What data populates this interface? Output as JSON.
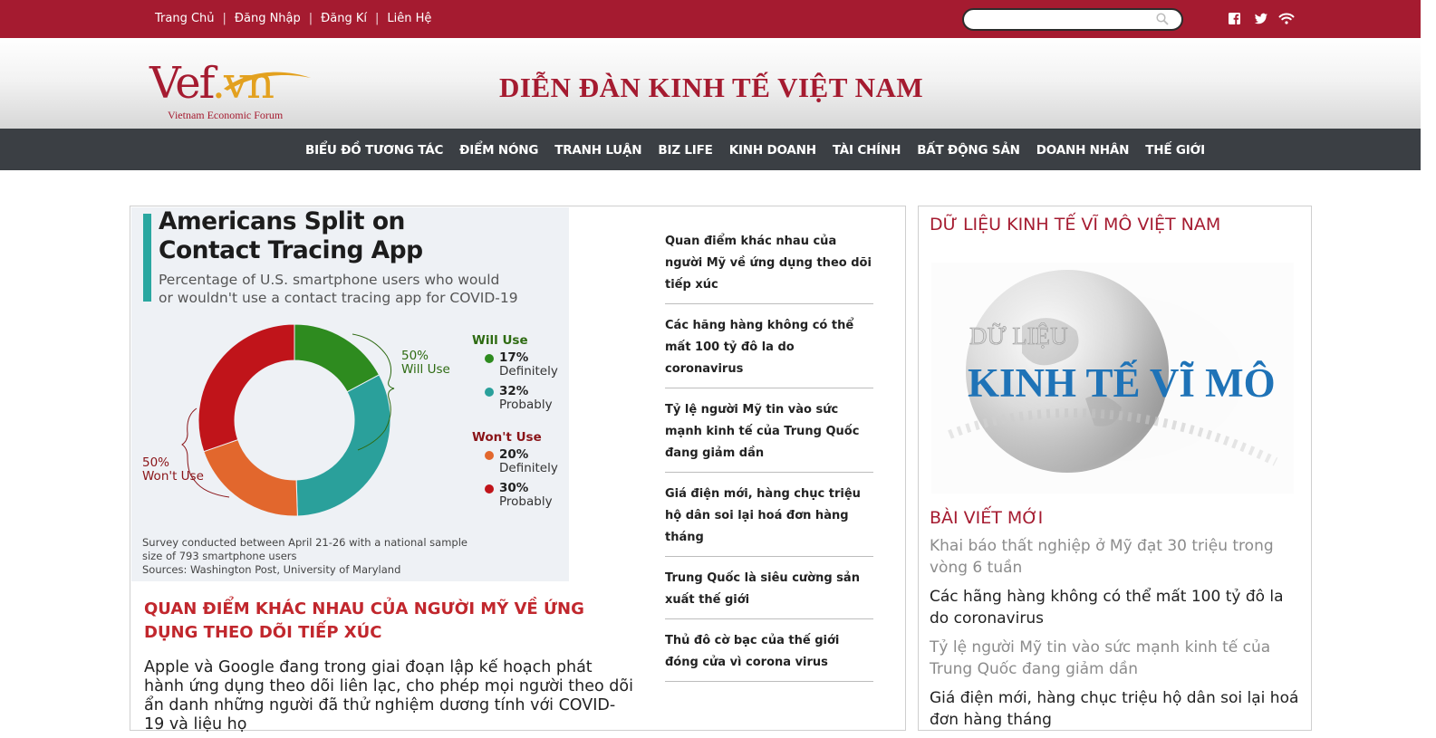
{
  "topbar": {
    "links": [
      "Trang Chủ",
      "Đăng Nhập",
      "Đăng Kí",
      "Liên Hệ"
    ],
    "search_placeholder": "",
    "social_icons": [
      "facebook-icon",
      "twitter-icon",
      "rss-icon"
    ]
  },
  "header": {
    "logo_text": "Vef",
    "logo_suffix": ".vn",
    "logo_tagline": "Vietnam Economic Forum",
    "site_title": "DIỄN ĐÀN KINH TẾ VIỆT NAM"
  },
  "nav": {
    "items": [
      "BIỂU ĐỒ TƯƠNG TÁC",
      "ĐIỂM NÓNG",
      "TRANH LUẬN",
      "BIZ LIFE",
      "KINH DOANH",
      "TÀI CHÍNH",
      "BẤT ĐỘNG SẢN",
      "DOANH NHÂN",
      "THẾ GIỚI"
    ]
  },
  "featured": {
    "image": {
      "title_line1": "Americans Split on",
      "title_line2": "Contact Tracing App",
      "subtitle_line1": "Percentage of U.S. smartphone users who would",
      "subtitle_line2": "or wouldn't use a contact tracing app for COVID-19",
      "will_use_label": "Will Use",
      "wont_use_label": "Won't Use",
      "will_pct": "50%",
      "will_group": "Will Use",
      "wont_pct": "50%",
      "wont_group": "Won't Use",
      "legend": [
        {
          "pct": "17%",
          "text": "Definitely",
          "color": "#2e8b1f"
        },
        {
          "pct": "32%",
          "text": "Probably",
          "color": "#2aa09b"
        },
        {
          "pct": "20%",
          "text": "Definitely",
          "color": "#e2672d"
        },
        {
          "pct": "30%",
          "text": "Probably",
          "color": "#c0141a"
        }
      ],
      "footnote_line1": "Survey conducted between April 21-26 with a national sample",
      "footnote_line2": "size of 793 smartphone users",
      "footnote_line3": "Sources: Washington Post, University of Maryland",
      "colors": {
        "will": "#2e6b12",
        "wont": "#8a1418",
        "bar": "#2aa7a0"
      }
    },
    "title": "QUAN ĐIỂM KHÁC NHAU CỦA NGƯỜI MỸ VỀ ỨNG DỤNG THEO DÕI TIẾP XÚC",
    "summary": "Apple và Google đang trong giai đoạn lập kế hoạch phát hành ứng dụng theo dõi liên lạc, cho phép mọi người theo dõi ẩn danh những người đã thử nghiệm dương tính với COVID-19 và liệu họ"
  },
  "related": [
    "Quan điểm khác nhau của người Mỹ về ứng dụng theo dõi tiếp xúc",
    "Các hãng hàng không có thể mất 100 tỷ đô la do coronavirus",
    "Tỷ lệ người Mỹ tin vào sức mạnh kinh tế của Trung Quốc đang giảm dần",
    "Giá điện mới, hàng chục triệu hộ dân soi lại hoá đơn hàng tháng",
    "Trung Quốc là siêu cường sản xuất thế giới",
    "Thủ đô cờ bạc của thế giới đóng cửa vì corona virus"
  ],
  "sidebar": {
    "macro_heading": "DỮ LIỆU KINH TẾ VĨ MÔ VIỆT NAM",
    "macro_banner_small": "DỮ LIỆU",
    "macro_banner_big": "KINH TẾ VĨ MÔ",
    "new_heading": "BÀI VIẾT MỚI",
    "new_posts": [
      {
        "text": "Khai báo thất nghiệp ở Mỹ đạt 30 triệu trong vòng 6 tuần",
        "color": "#8c8c8c"
      },
      {
        "text": "Các hãng hàng không có thể mất 100 tỷ đô la do coronavirus",
        "color": "#222222"
      },
      {
        "text": "Tỷ lệ người Mỹ tin vào sức mạnh kinh tế của Trung Quốc đang giảm dần",
        "color": "#8c8c8c"
      },
      {
        "text": "Giá điện mới, hàng chục triệu hộ dân soi lại hoá đơn hàng tháng",
        "color": "#222222"
      }
    ]
  },
  "chart_data": {
    "type": "pie",
    "title": "Americans Split on Contact Tracing App",
    "subtitle": "Percentage of U.S. smartphone users who would or wouldn't use a contact tracing app for COVID-19",
    "categories": [
      "Will Use - Definitely",
      "Will Use - Probably",
      "Won't Use - Definitely",
      "Won't Use - Probably"
    ],
    "values": [
      17,
      32,
      20,
      30
    ],
    "colors": [
      "#2e8b1f",
      "#2aa09b",
      "#e2672d",
      "#c0141a"
    ]
  }
}
